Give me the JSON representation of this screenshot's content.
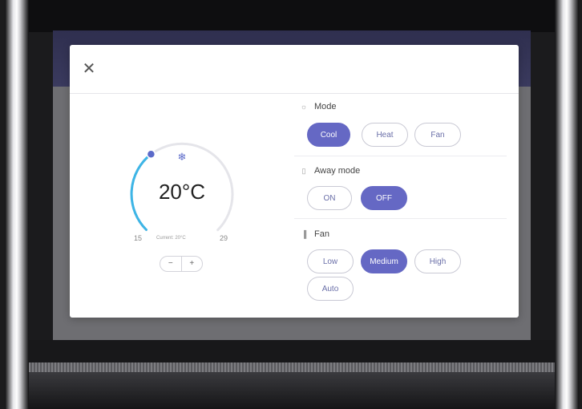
{
  "modal": {
    "close_icon": "close-icon"
  },
  "thermostat": {
    "temperature": "20°C",
    "min": "15",
    "max": "29",
    "current": "Current: 20°C",
    "mode_icon": "snowflake-icon",
    "setpoint_fraction": 0.36,
    "stepper": {
      "decrease": "−",
      "increase": "+"
    },
    "arc_color": "#3db5e6",
    "handle_color": "#5b6ac9"
  },
  "sections": {
    "mode": {
      "title": "Mode",
      "icon": "thermostat-icon",
      "options": [
        "Cool",
        "Heat",
        "Fan"
      ],
      "selected": "Cool"
    },
    "away": {
      "title": "Away mode",
      "icon": "door-icon",
      "options": [
        "ON",
        "OFF"
      ],
      "selected": "OFF"
    },
    "fan": {
      "title": "Fan",
      "icon": "signal-bars-icon",
      "options": [
        "Low",
        "Medium",
        "High",
        "Auto"
      ],
      "selected": "Medium"
    }
  },
  "colors": {
    "accent": "#6568c4",
    "text_accent": "#6a6fa8"
  }
}
